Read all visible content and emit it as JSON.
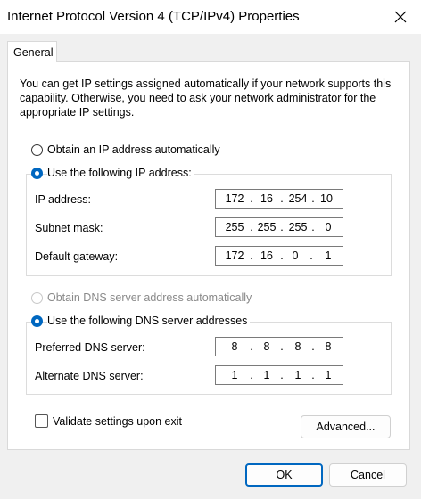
{
  "window": {
    "title": "Internet Protocol Version 4 (TCP/IPv4) Properties"
  },
  "tabs": [
    {
      "label": "General"
    }
  ],
  "description": "You can get IP settings assigned automatically if your network supports this capability. Otherwise, you need to ask your network administrator for the appropriate IP settings.",
  "ip_section": {
    "auto_label": "Obtain an IP address automatically",
    "auto_checked": false,
    "manual_label": "Use the following IP address:",
    "manual_checked": true,
    "fields": {
      "ip_address": {
        "label": "IP address:",
        "octets": [
          "172",
          "16",
          "254",
          "10"
        ]
      },
      "subnet_mask": {
        "label": "Subnet mask:",
        "octets": [
          "255",
          "255",
          "255",
          "0"
        ]
      },
      "default_gateway": {
        "label": "Default gateway:",
        "octets": [
          "172",
          "16",
          "0",
          "1"
        ]
      }
    }
  },
  "dns_section": {
    "auto_label": "Obtain DNS server address automatically",
    "auto_enabled": false,
    "manual_label": "Use the following DNS server addresses",
    "manual_checked": true,
    "fields": {
      "preferred": {
        "label": "Preferred DNS server:",
        "octets": [
          "8",
          "8",
          "8",
          "8"
        ]
      },
      "alternate": {
        "label": "Alternate DNS server:",
        "octets": [
          "1",
          "1",
          "1",
          "1"
        ]
      }
    }
  },
  "validate": {
    "label": "Validate settings upon exit",
    "checked": false
  },
  "buttons": {
    "advanced": "Advanced...",
    "ok": "OK",
    "cancel": "Cancel"
  },
  "icons": {
    "close": "close-icon"
  },
  "colors": {
    "accent": "#0067c0"
  }
}
